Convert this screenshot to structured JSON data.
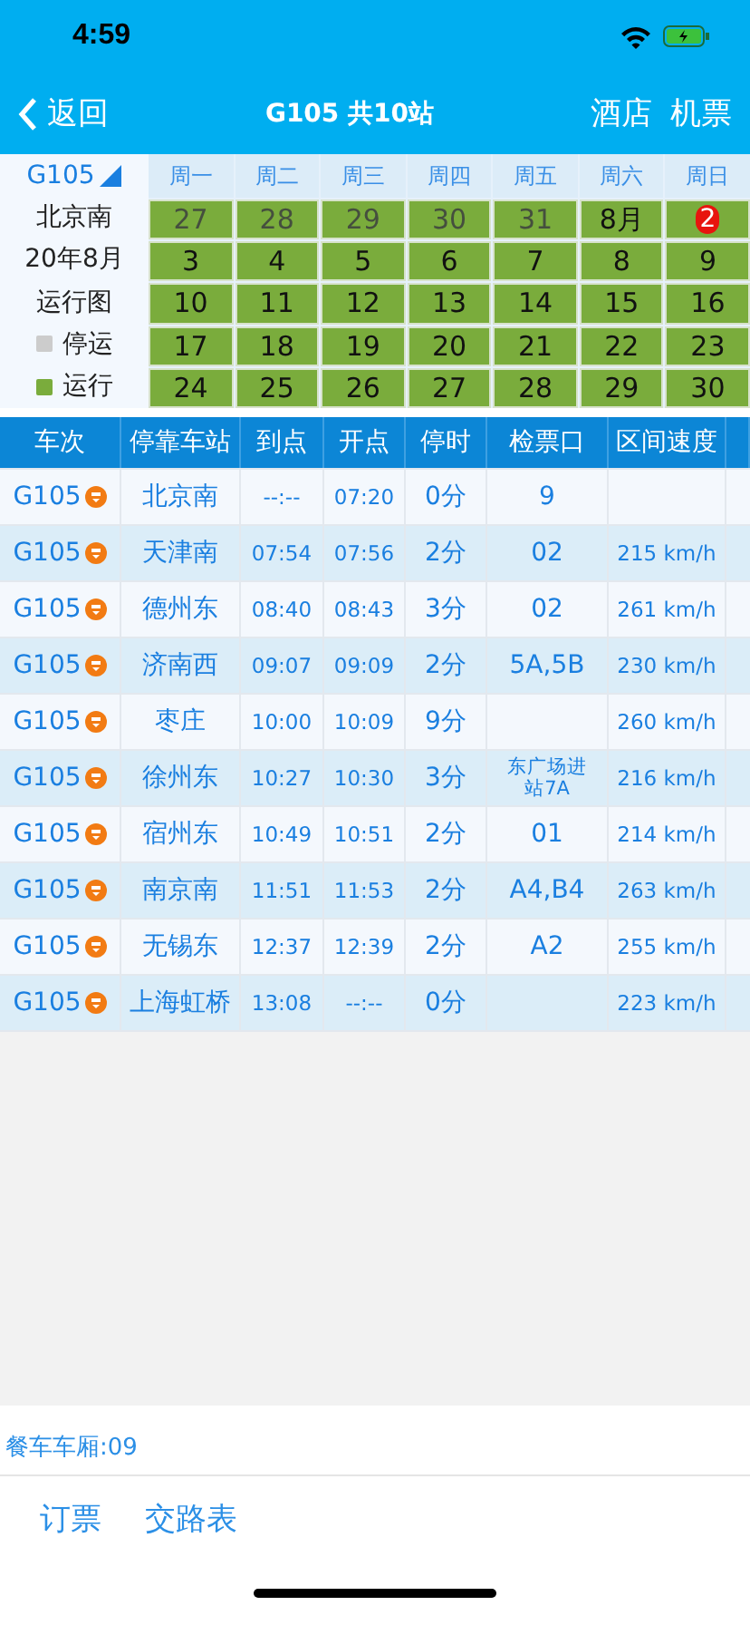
{
  "status_bar": {
    "time": "4:59"
  },
  "nav": {
    "back": "返回",
    "title": "G105 共10站",
    "actions": [
      "酒店",
      "机票"
    ]
  },
  "calendar": {
    "train": "G105",
    "station": "北京南",
    "month": "20年8月",
    "diagram": "运行图",
    "legend": [
      {
        "label": "停运",
        "color": "#cccccc"
      },
      {
        "label": "运行",
        "color": "#7aac3c"
      }
    ],
    "weekdays": [
      "周一",
      "周二",
      "周三",
      "周四",
      "周五",
      "周六",
      "周日"
    ],
    "weeks": [
      [
        {
          "text": "27",
          "kind": "prev"
        },
        {
          "text": "28",
          "kind": "prev"
        },
        {
          "text": "29",
          "kind": "prev"
        },
        {
          "text": "30",
          "kind": "prev"
        },
        {
          "text": "31",
          "kind": "prev"
        },
        {
          "text": "8月",
          "kind": "month"
        },
        {
          "text": "2",
          "kind": "today"
        }
      ],
      [
        {
          "text": "3",
          "kind": "day"
        },
        {
          "text": "4",
          "kind": "day"
        },
        {
          "text": "5",
          "kind": "day"
        },
        {
          "text": "6",
          "kind": "day"
        },
        {
          "text": "7",
          "kind": "day"
        },
        {
          "text": "8",
          "kind": "day"
        },
        {
          "text": "9",
          "kind": "day"
        }
      ],
      [
        {
          "text": "10",
          "kind": "day"
        },
        {
          "text": "11",
          "kind": "day"
        },
        {
          "text": "12",
          "kind": "day"
        },
        {
          "text": "13",
          "kind": "day"
        },
        {
          "text": "14",
          "kind": "day"
        },
        {
          "text": "15",
          "kind": "day"
        },
        {
          "text": "16",
          "kind": "day"
        }
      ],
      [
        {
          "text": "17",
          "kind": "day"
        },
        {
          "text": "18",
          "kind": "day"
        },
        {
          "text": "19",
          "kind": "day"
        },
        {
          "text": "20",
          "kind": "day"
        },
        {
          "text": "21",
          "kind": "day"
        },
        {
          "text": "22",
          "kind": "day"
        },
        {
          "text": "23",
          "kind": "day"
        }
      ],
      [
        {
          "text": "24",
          "kind": "day"
        },
        {
          "text": "25",
          "kind": "day"
        },
        {
          "text": "26",
          "kind": "day"
        },
        {
          "text": "27",
          "kind": "day"
        },
        {
          "text": "28",
          "kind": "day"
        },
        {
          "text": "29",
          "kind": "day"
        },
        {
          "text": "30",
          "kind": "day"
        }
      ]
    ]
  },
  "table": {
    "columns": [
      "车次",
      "停靠车站",
      "到点",
      "开点",
      "停时",
      "检票口",
      "区间速度"
    ],
    "rows": [
      {
        "train": "G105",
        "station": "北京南",
        "arrive": "--:--",
        "depart": "07:20",
        "stop": "0分",
        "gate": "9",
        "speed": ""
      },
      {
        "train": "G105",
        "station": "天津南",
        "arrive": "07:54",
        "depart": "07:56",
        "stop": "2分",
        "gate": "02",
        "speed": "215 km/h"
      },
      {
        "train": "G105",
        "station": "德州东",
        "arrive": "08:40",
        "depart": "08:43",
        "stop": "3分",
        "gate": "02",
        "speed": "261 km/h"
      },
      {
        "train": "G105",
        "station": "济南西",
        "arrive": "09:07",
        "depart": "09:09",
        "stop": "2分",
        "gate": "5A,5B",
        "speed": "230 km/h"
      },
      {
        "train": "G105",
        "station": "枣庄",
        "arrive": "10:00",
        "depart": "10:09",
        "stop": "9分",
        "gate": "",
        "speed": "260 km/h"
      },
      {
        "train": "G105",
        "station": "徐州东",
        "arrive": "10:27",
        "depart": "10:30",
        "stop": "3分",
        "gate": "东广场进站7A",
        "speed": "216 km/h"
      },
      {
        "train": "G105",
        "station": "宿州东",
        "arrive": "10:49",
        "depart": "10:51",
        "stop": "2分",
        "gate": "01",
        "speed": "214 km/h"
      },
      {
        "train": "G105",
        "station": "南京南",
        "arrive": "11:51",
        "depart": "11:53",
        "stop": "2分",
        "gate": "A4,B4",
        "speed": "263 km/h"
      },
      {
        "train": "G105",
        "station": "无锡东",
        "arrive": "12:37",
        "depart": "12:39",
        "stop": "2分",
        "gate": "A2",
        "speed": "255 km/h"
      },
      {
        "train": "G105",
        "station": "上海虹桥",
        "arrive": "13:08",
        "depart": "--:--",
        "stop": "0分",
        "gate": "",
        "speed": "223 km/h"
      }
    ]
  },
  "dining_car": "餐车车厢:09",
  "bottom_tabs": [
    "订票",
    "交路表"
  ]
}
